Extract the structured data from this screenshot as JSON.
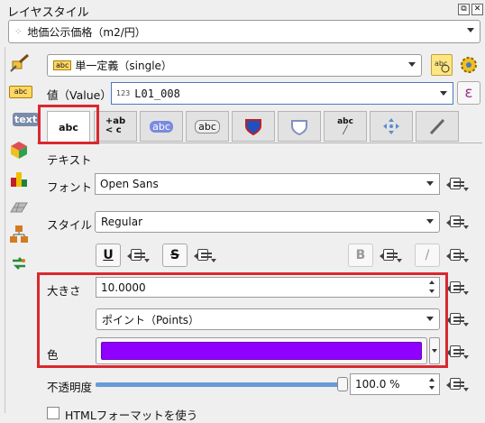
{
  "panel": {
    "title": "レイヤスタイル",
    "float_glyph": "⧉",
    "close_glyph": "✕"
  },
  "layer_combo": {
    "value": "地価公示価格（m2/円）"
  },
  "renderer": {
    "value": "単一定義（single）",
    "badge": "abc"
  },
  "value_row": {
    "label": "値（Value）",
    "badge": "abc",
    "prefix": "123",
    "value": "L01_008",
    "expr_glyph": "ε"
  },
  "tabs": [
    {
      "label": "abc"
    },
    {
      "label": "+ab < c"
    },
    {
      "label": "abc"
    },
    {
      "label": "abc"
    },
    {
      "label": "shield"
    },
    {
      "label": "callout"
    },
    {
      "label": "abc /"
    },
    {
      "label": "placement"
    },
    {
      "label": "rendering"
    }
  ],
  "sidebar": {
    "items": [
      {
        "name": "text"
      },
      {
        "name": "3d-box"
      },
      {
        "name": "palette"
      },
      {
        "name": "grid"
      },
      {
        "name": "hierarchy"
      },
      {
        "name": "arrows"
      }
    ]
  },
  "section": {
    "heading": "テキスト"
  },
  "font_row": {
    "label": "フォント",
    "value": "Open Sans"
  },
  "style_row": {
    "label": "スタイル",
    "value": "Regular"
  },
  "format_buttons": {
    "underline": "U",
    "strike": "S",
    "bold": "B",
    "italic": "/"
  },
  "size_row": {
    "label": "大きさ",
    "value": "10.0000"
  },
  "unit_row": {
    "value": "ポイント（Points）"
  },
  "color_row": {
    "label": "色",
    "color": "#8f00ff"
  },
  "opacity_row": {
    "label": "不透明度",
    "value": "100.0 %",
    "level": 1.0
  },
  "html_row": {
    "label": "HTMLフォーマットを使う"
  }
}
